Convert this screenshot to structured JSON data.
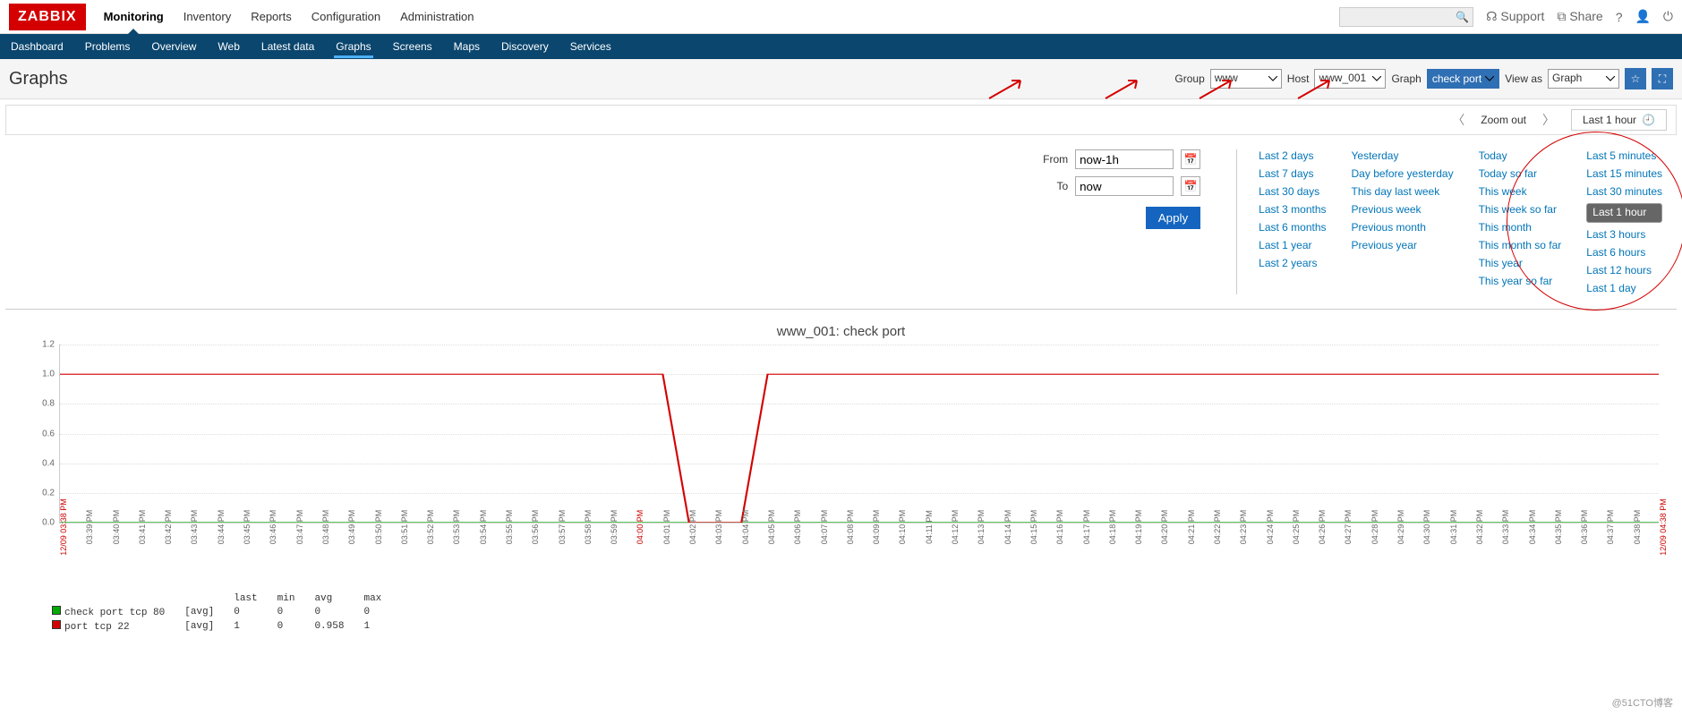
{
  "brand": "ZABBIX",
  "mainmenu": [
    "Monitoring",
    "Inventory",
    "Reports",
    "Configuration",
    "Administration"
  ],
  "mainmenu_active": "Monitoring",
  "top_links": {
    "support": "Support",
    "share": "Share"
  },
  "submenu": [
    "Dashboard",
    "Problems",
    "Overview",
    "Web",
    "Latest data",
    "Graphs",
    "Screens",
    "Maps",
    "Discovery",
    "Services"
  ],
  "submenu_active": "Graphs",
  "page_title": "Graphs",
  "filters": {
    "group_label": "Group",
    "group_value": "www",
    "host_label": "Host",
    "host_value": "www_001",
    "graph_label": "Graph",
    "graph_value": "check port",
    "viewas_label": "View as",
    "viewas_value": "Graph"
  },
  "timebar": {
    "zoomout": "Zoom out",
    "range": "Last 1 hour"
  },
  "fromto": {
    "from_label": "From",
    "from_value": "now-1h",
    "to_label": "To",
    "to_value": "now",
    "apply": "Apply"
  },
  "quick": {
    "col1": [
      "Last 2 days",
      "Last 7 days",
      "Last 30 days",
      "Last 3 months",
      "Last 6 months",
      "Last 1 year",
      "Last 2 years"
    ],
    "col2": [
      "Yesterday",
      "Day before yesterday",
      "This day last week",
      "Previous week",
      "Previous month",
      "Previous year"
    ],
    "col3": [
      "Today",
      "Today so far",
      "This week",
      "This week so far",
      "This month",
      "This month so far",
      "This year",
      "This year so far"
    ],
    "col4": [
      "Last 5 minutes",
      "Last 15 minutes",
      "Last 30 minutes",
      "Last 1 hour",
      "Last 3 hours",
      "Last 6 hours",
      "Last 12 hours",
      "Last 1 day"
    ],
    "col4_selected": "Last 1 hour"
  },
  "chart_data": {
    "type": "line",
    "title": "www_001: check port",
    "ylim": [
      0,
      1.2
    ],
    "yticks": [
      0.0,
      0.2,
      0.4,
      0.6,
      0.8,
      1.0,
      1.2
    ],
    "xticks": [
      "12/09 03:38 PM",
      "03:39 PM",
      "03:40 PM",
      "03:41 PM",
      "03:42 PM",
      "03:43 PM",
      "03:44 PM",
      "03:45 PM",
      "03:46 PM",
      "03:47 PM",
      "03:48 PM",
      "03:49 PM",
      "03:50 PM",
      "03:51 PM",
      "03:52 PM",
      "03:53 PM",
      "03:54 PM",
      "03:55 PM",
      "03:56 PM",
      "03:57 PM",
      "03:58 PM",
      "03:59 PM",
      "04:00 PM",
      "04:01 PM",
      "04:02 PM",
      "04:03 PM",
      "04:04 PM",
      "04:05 PM",
      "04:06 PM",
      "04:07 PM",
      "04:08 PM",
      "04:09 PM",
      "04:10 PM",
      "04:11 PM",
      "04:12 PM",
      "04:13 PM",
      "04:14 PM",
      "04:15 PM",
      "04:16 PM",
      "04:17 PM",
      "04:18 PM",
      "04:19 PM",
      "04:20 PM",
      "04:21 PM",
      "04:22 PM",
      "04:23 PM",
      "04:24 PM",
      "04:25 PM",
      "04:26 PM",
      "04:27 PM",
      "04:28 PM",
      "04:29 PM",
      "04:30 PM",
      "04:31 PM",
      "04:32 PM",
      "04:33 PM",
      "04:34 PM",
      "04:35 PM",
      "04:36 PM",
      "04:37 PM",
      "04:38 PM",
      "12/09 04:38 PM"
    ],
    "xticks_red": [
      "12/09 03:38 PM",
      "04:00 PM",
      "12/09 04:38 PM"
    ],
    "series": [
      {
        "name": "check port tcp 80",
        "color": "#00aa00",
        "agg": "avg",
        "stats": {
          "last": 0,
          "min": 0,
          "avg": 0,
          "max": 0
        },
        "values": [
          0,
          0,
          0,
          0,
          0,
          0,
          0,
          0,
          0,
          0,
          0,
          0,
          0,
          0,
          0,
          0,
          0,
          0,
          0,
          0,
          0,
          0,
          0,
          0,
          0,
          0,
          0,
          0,
          0,
          0,
          0,
          0,
          0,
          0,
          0,
          0,
          0,
          0,
          0,
          0,
          0,
          0,
          0,
          0,
          0,
          0,
          0,
          0,
          0,
          0,
          0,
          0,
          0,
          0,
          0,
          0,
          0,
          0,
          0,
          0,
          0,
          0
        ]
      },
      {
        "name": "port tcp 22",
        "color": "#d40000",
        "agg": "avg",
        "stats": {
          "last": 1,
          "min": 0,
          "avg": 0.958,
          "max": 1
        },
        "values": [
          1,
          1,
          1,
          1,
          1,
          1,
          1,
          1,
          1,
          1,
          1,
          1,
          1,
          1,
          1,
          1,
          1,
          1,
          1,
          1,
          1,
          1,
          1,
          1,
          0,
          0,
          0,
          1,
          1,
          1,
          1,
          1,
          1,
          1,
          1,
          1,
          1,
          1,
          1,
          1,
          1,
          1,
          1,
          1,
          1,
          1,
          1,
          1,
          1,
          1,
          1,
          1,
          1,
          1,
          1,
          1,
          1,
          1,
          1,
          1,
          1,
          1
        ]
      }
    ],
    "legend_headers": [
      "",
      "",
      "last",
      "min",
      "avg",
      "max"
    ]
  },
  "watermark": "@51CTO博客"
}
